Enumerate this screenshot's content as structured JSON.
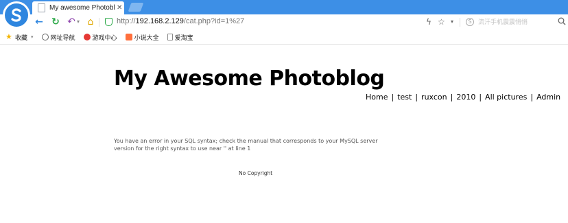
{
  "browser": {
    "tab_title": "My awesome Photoblo",
    "url": {
      "scheme": "http://",
      "host": "192.168.2.129",
      "path": "/cat.php?id=1%27"
    },
    "search_placeholder": "流汗手机震震悄悄",
    "bookmarks": [
      {
        "label": "收藏",
        "icon": "star-icon"
      },
      {
        "label": "网址导航",
        "icon": "globe-icon"
      },
      {
        "label": "游戏中心",
        "icon": "game-icon"
      },
      {
        "label": "小说大全",
        "icon": "book-icon"
      },
      {
        "label": "爱淘宝",
        "icon": "page-icon"
      }
    ]
  },
  "page": {
    "site_title": "My Awesome Photoblog",
    "nav": [
      "Home",
      "test",
      "ruxcon",
      "2010",
      "All pictures",
      "Admin"
    ],
    "nav_separator": "|",
    "sql_error": "You have an error in your SQL syntax; check the manual that corresponds to your MySQL server version for the right syntax to use near '' at line 1",
    "footer": "No Copyright"
  },
  "colors": {
    "tabstrip": "#3d8fe6",
    "secure": "#28a745",
    "back": "#2f86df"
  }
}
